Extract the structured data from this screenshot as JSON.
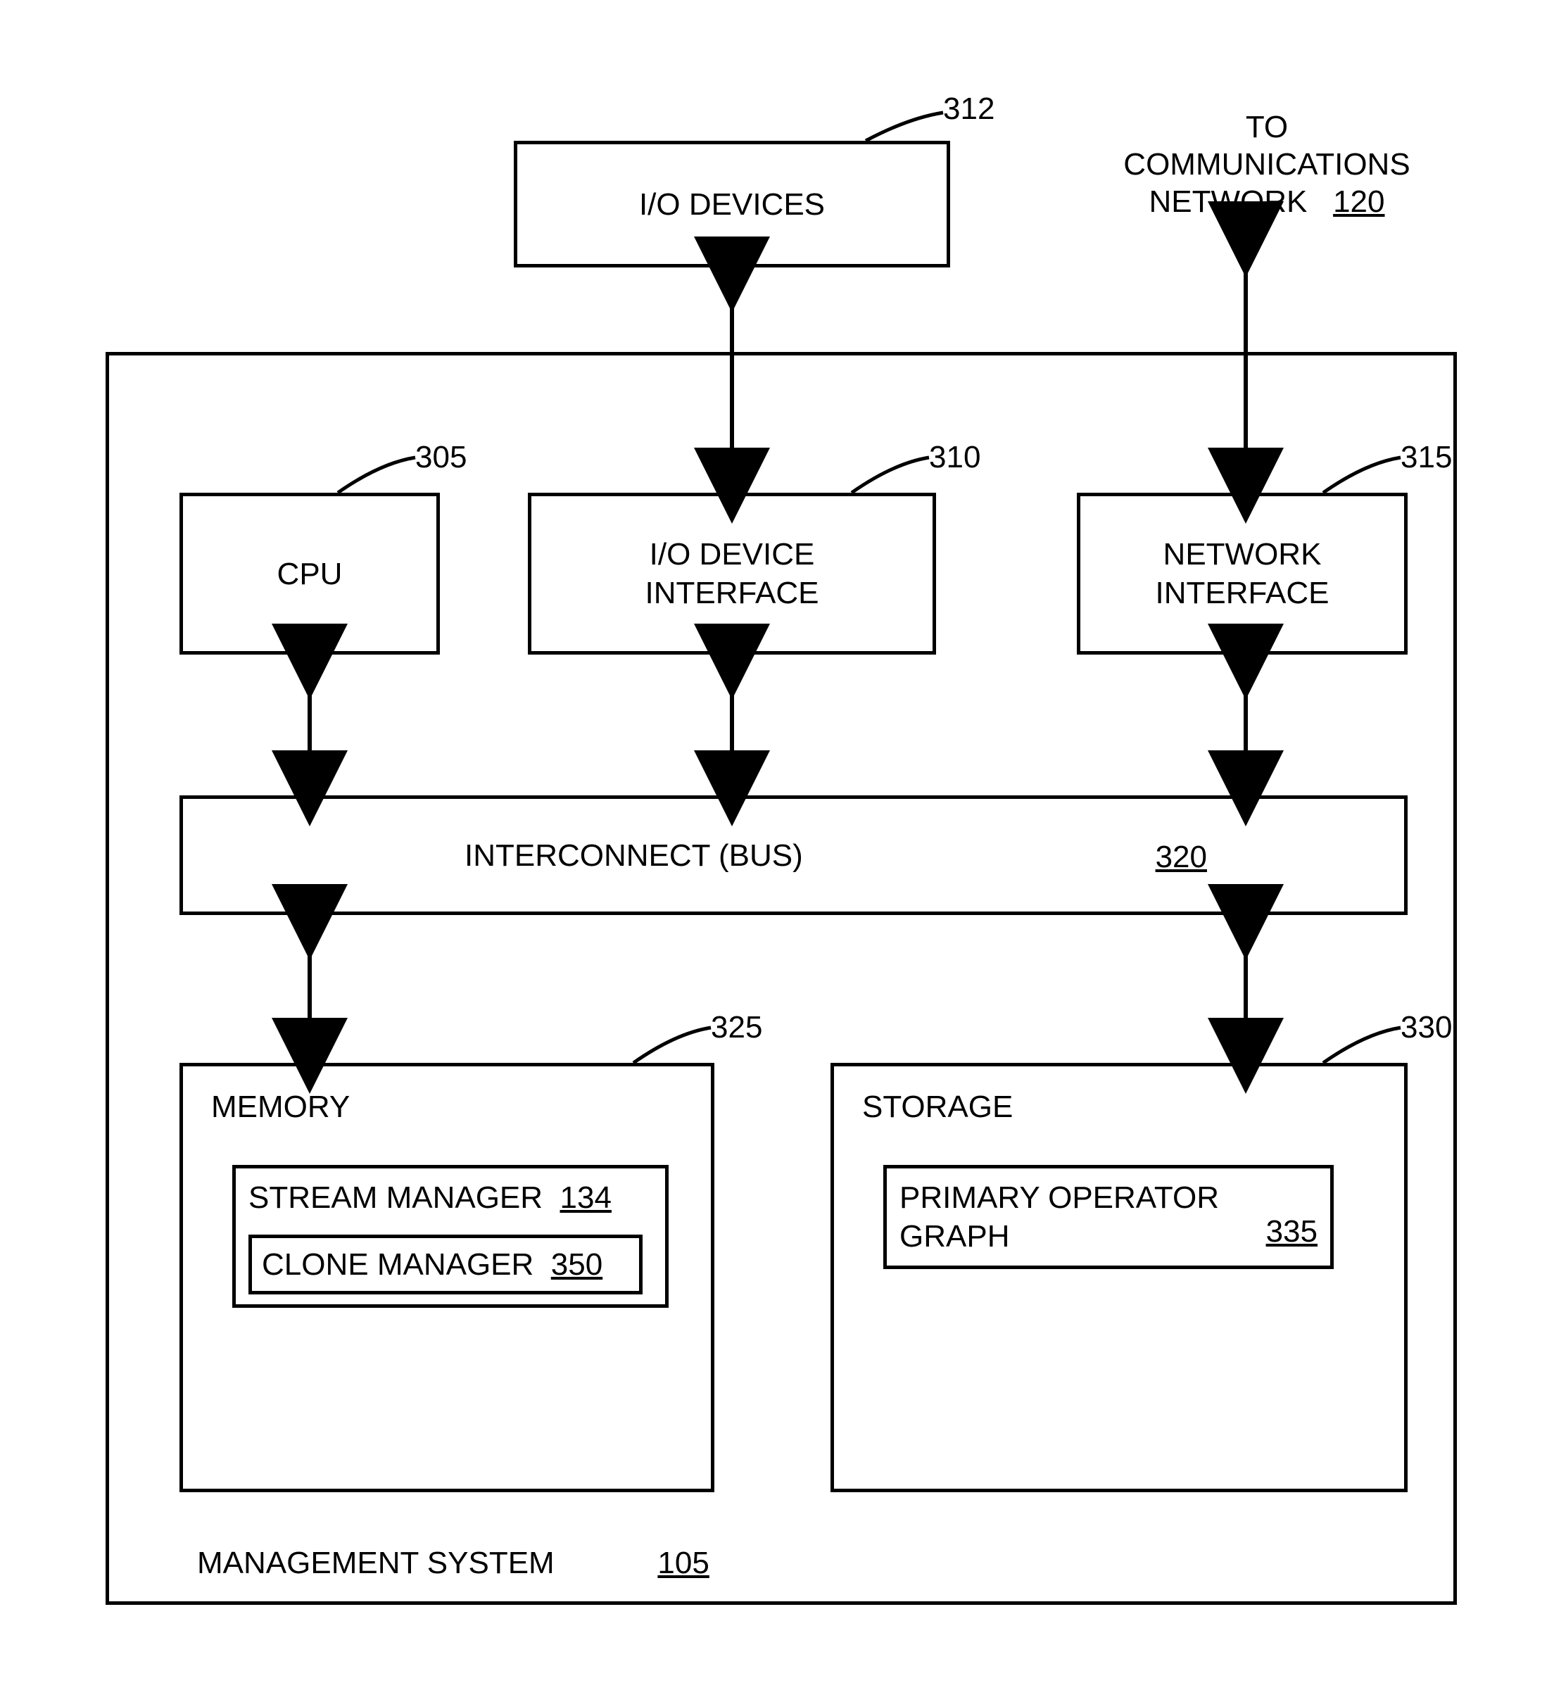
{
  "io_devices": {
    "label": "I/O DEVICES",
    "ref": "312"
  },
  "comm_network": {
    "prefix": "TO",
    "line2": "COMMUNICATIONS",
    "line3": "NETWORK",
    "ref": "120"
  },
  "cpu": {
    "label": "CPU",
    "ref": "305"
  },
  "io_iface": {
    "label": "I/O DEVICE\nINTERFACE",
    "ref": "310"
  },
  "net_iface": {
    "label": "NETWORK\nINTERFACE",
    "ref": "315"
  },
  "bus": {
    "label": "INTERCONNECT (BUS)",
    "ref": "320"
  },
  "memory_box": {
    "title": "MEMORY",
    "ref": "325"
  },
  "stream_mgr": {
    "label": "STREAM MANAGER",
    "ref": "134"
  },
  "clone_mgr": {
    "label": "CLONE MANAGER",
    "ref": "350"
  },
  "storage_box": {
    "title": "STORAGE",
    "ref": "330"
  },
  "primary_op": {
    "label": "PRIMARY OPERATOR\nGRAPH",
    "ref": "335"
  },
  "mgmt_system": {
    "label": "MANAGEMENT SYSTEM",
    "ref": "105"
  }
}
